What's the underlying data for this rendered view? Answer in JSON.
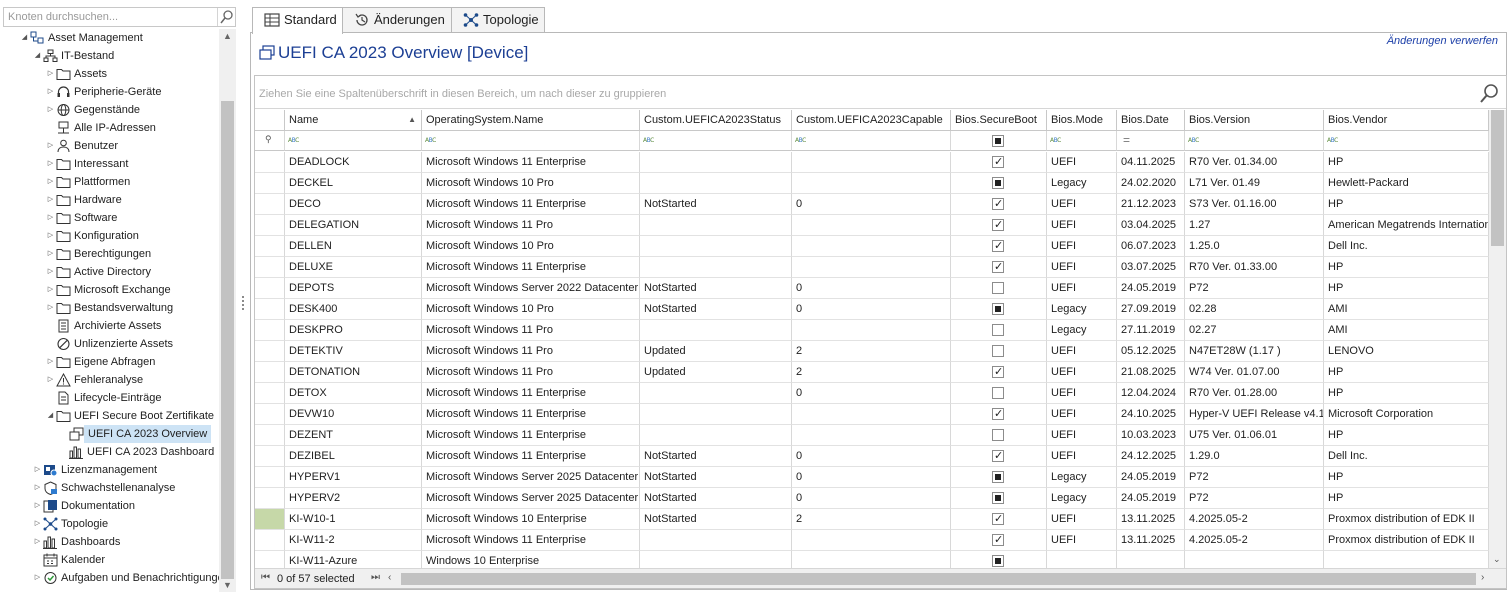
{
  "left_panel": {
    "search_placeholder": "Knoten durchsuchen...",
    "tree": [
      {
        "label": "Asset Management",
        "level": 0,
        "expanded": true,
        "icon": "asset-management-icon"
      },
      {
        "label": "IT-Bestand",
        "level": 1,
        "expanded": true,
        "icon": "network-icon"
      },
      {
        "label": "Assets",
        "level": 2,
        "expanded": false,
        "icon": "folder-icon"
      },
      {
        "label": "Peripherie-Geräte",
        "level": 2,
        "expanded": false,
        "icon": "headset-icon"
      },
      {
        "label": "Gegenstände",
        "level": 2,
        "expanded": false,
        "icon": "globe-icon"
      },
      {
        "label": "Alle IP-Adressen",
        "level": 2,
        "expanded": null,
        "icon": "ip-network-icon"
      },
      {
        "label": "Benutzer",
        "level": 2,
        "expanded": false,
        "icon": "user-icon"
      },
      {
        "label": "Interessant",
        "level": 2,
        "expanded": false,
        "icon": "folder-icon"
      },
      {
        "label": "Plattformen",
        "level": 2,
        "expanded": false,
        "icon": "folder-icon"
      },
      {
        "label": "Hardware",
        "level": 2,
        "expanded": false,
        "icon": "folder-icon"
      },
      {
        "label": "Software",
        "level": 2,
        "expanded": false,
        "icon": "folder-icon"
      },
      {
        "label": "Konfiguration",
        "level": 2,
        "expanded": false,
        "icon": "folder-icon"
      },
      {
        "label": "Berechtigungen",
        "level": 2,
        "expanded": false,
        "icon": "folder-icon"
      },
      {
        "label": "Active Directory",
        "level": 2,
        "expanded": false,
        "icon": "folder-icon"
      },
      {
        "label": "Microsoft Exchange",
        "level": 2,
        "expanded": false,
        "icon": "folder-icon"
      },
      {
        "label": "Bestandsverwaltung",
        "level": 2,
        "expanded": false,
        "icon": "folder-icon"
      },
      {
        "label": "Archivierte Assets",
        "level": 2,
        "expanded": null,
        "icon": "archive-icon"
      },
      {
        "label": "Unlizenzierte Assets",
        "level": 2,
        "expanded": null,
        "icon": "forbidden-icon"
      },
      {
        "label": "Eigene Abfragen",
        "level": 2,
        "expanded": false,
        "icon": "folder-icon"
      },
      {
        "label": "Fehleranalyse",
        "level": 2,
        "expanded": false,
        "icon": "warning-icon"
      },
      {
        "label": "Lifecycle-Einträge",
        "level": 2,
        "expanded": null,
        "icon": "document-icon"
      },
      {
        "label": "UEFI Secure Boot Zertifikate",
        "level": 2,
        "expanded": true,
        "icon": "folder-icon"
      },
      {
        "label": "UEFI CA 2023 Overview",
        "level": 3,
        "expanded": null,
        "icon": "view-icon",
        "selected": true
      },
      {
        "label": "UEFI CA 2023 Dashboard",
        "level": 3,
        "expanded": null,
        "icon": "bar-chart-icon"
      },
      {
        "label": "Lizenzmanagement",
        "level": 1,
        "expanded": false,
        "icon": "license-icon"
      },
      {
        "label": "Schwachstellenanalyse",
        "level": 1,
        "expanded": false,
        "icon": "shield-icon"
      },
      {
        "label": "Dokumentation",
        "level": 1,
        "expanded": false,
        "icon": "documentation-icon"
      },
      {
        "label": "Topologie",
        "level": 1,
        "expanded": false,
        "icon": "topology-icon"
      },
      {
        "label": "Dashboards",
        "level": 1,
        "expanded": false,
        "icon": "bar-chart-icon"
      },
      {
        "label": "Kalender",
        "level": 1,
        "expanded": null,
        "icon": "calendar-icon"
      },
      {
        "label": "Aufgaben und Benachrichtigungen",
        "level": 1,
        "expanded": false,
        "icon": "tasks-icon"
      }
    ]
  },
  "tabs": [
    {
      "label": "Standard",
      "icon": "table-icon",
      "active": true
    },
    {
      "label": "Änderungen",
      "icon": "history-icon",
      "active": false
    },
    {
      "label": "Topologie",
      "icon": "topology-icon",
      "active": false
    }
  ],
  "view": {
    "title": "UEFI CA 2023 Overview  [Device]",
    "discard_link": "Änderungen verwerfen",
    "group_panel_text": "Ziehen Sie eine Spaltenüberschrift in diesen Bereich, um nach dieser zu gruppieren"
  },
  "grid": {
    "columns": [
      "Name",
      "OperatingSystem.Name",
      "Custom.UEFICA2023Status",
      "Custom.UEFICA2023Capable",
      "Bios.SecureBoot",
      "Bios.Mode",
      "Bios.Date",
      "Bios.Version",
      "Bios.Vendor"
    ],
    "sorted_column": "Name",
    "rows": [
      {
        "name": "DEADLOCK",
        "os": "Microsoft Windows 11 Enterprise",
        "status": "",
        "capable": "",
        "secureboot": "checked",
        "mode": "UEFI",
        "date": "04.11.2025",
        "version": "R70 Ver. 01.34.00",
        "vendor": "HP"
      },
      {
        "name": "DECKEL",
        "os": "Microsoft Windows 10 Pro",
        "status": "",
        "capable": "",
        "secureboot": "indeterminate",
        "mode": "Legacy",
        "date": "24.02.2020",
        "version": "L71 Ver. 01.49",
        "vendor": "Hewlett-Packard"
      },
      {
        "name": "DECO",
        "os": "Microsoft Windows 11 Enterprise",
        "status": "NotStarted",
        "capable": "0",
        "secureboot": "checked",
        "mode": "UEFI",
        "date": "21.12.2023",
        "version": "S73 Ver. 01.16.00",
        "vendor": "HP"
      },
      {
        "name": "DELEGATION",
        "os": "Microsoft Windows 11 Pro",
        "status": "",
        "capable": "",
        "secureboot": "checked",
        "mode": "UEFI",
        "date": "03.04.2025",
        "version": "1.27",
        "vendor": "American Megatrends International"
      },
      {
        "name": "DELLEN",
        "os": "Microsoft Windows 10 Pro",
        "status": "",
        "capable": "",
        "secureboot": "checked",
        "mode": "UEFI",
        "date": "06.07.2023",
        "version": "1.25.0",
        "vendor": "Dell Inc."
      },
      {
        "name": "DELUXE",
        "os": "Microsoft Windows 11 Enterprise",
        "status": "",
        "capable": "",
        "secureboot": "checked",
        "mode": "UEFI",
        "date": "03.07.2025",
        "version": "R70 Ver. 01.33.00",
        "vendor": "HP"
      },
      {
        "name": "DEPOTS",
        "os": "Microsoft Windows Server 2022 Datacenter",
        "status": "NotStarted",
        "capable": "0",
        "secureboot": "unchecked",
        "mode": "UEFI",
        "date": "24.05.2019",
        "version": "P72",
        "vendor": "HP"
      },
      {
        "name": "DESK400",
        "os": "Microsoft Windows 10 Pro",
        "status": "NotStarted",
        "capable": "0",
        "secureboot": "indeterminate",
        "mode": "Legacy",
        "date": "27.09.2019",
        "version": "02.28",
        "vendor": "AMI"
      },
      {
        "name": "DESKPRO",
        "os": "Microsoft Windows 11 Pro",
        "status": "",
        "capable": "",
        "secureboot": "unchecked",
        "mode": "Legacy",
        "date": "27.11.2019",
        "version": "02.27",
        "vendor": "AMI"
      },
      {
        "name": "DETEKTIV",
        "os": "Microsoft Windows 11 Pro",
        "status": "Updated",
        "capable": "2",
        "secureboot": "unchecked",
        "mode": "UEFI",
        "date": "05.12.2025",
        "version": "N47ET28W (1.17 )",
        "vendor": "LENOVO"
      },
      {
        "name": "DETONATION",
        "os": "Microsoft Windows 11 Pro",
        "status": "Updated",
        "capable": "2",
        "secureboot": "checked",
        "mode": "UEFI",
        "date": "21.08.2025",
        "version": "W74 Ver. 01.07.00",
        "vendor": "HP"
      },
      {
        "name": "DETOX",
        "os": "Microsoft Windows 11 Enterprise",
        "status": "",
        "capable": "0",
        "secureboot": "unchecked",
        "mode": "UEFI",
        "date": "12.04.2024",
        "version": "R70 Ver. 01.28.00",
        "vendor": "HP"
      },
      {
        "name": "DEVW10",
        "os": "Microsoft Windows 11 Enterprise",
        "status": "",
        "capable": "",
        "secureboot": "checked",
        "mode": "UEFI",
        "date": "24.10.2025",
        "version": "Hyper-V UEFI Release v4.1",
        "vendor": "Microsoft Corporation"
      },
      {
        "name": "DEZENT",
        "os": "Microsoft Windows 11 Enterprise",
        "status": "",
        "capable": "",
        "secureboot": "unchecked",
        "mode": "UEFI",
        "date": "10.03.2023",
        "version": "U75 Ver. 01.06.01",
        "vendor": "HP"
      },
      {
        "name": "DEZIBEL",
        "os": "Microsoft Windows 11 Enterprise",
        "status": "NotStarted",
        "capable": "0",
        "secureboot": "checked",
        "mode": "UEFI",
        "date": "24.12.2025",
        "version": "1.29.0",
        "vendor": "Dell Inc."
      },
      {
        "name": "HYPERV1",
        "os": "Microsoft Windows Server 2025 Datacenter",
        "status": "NotStarted",
        "capable": "0",
        "secureboot": "indeterminate",
        "mode": "Legacy",
        "date": "24.05.2019",
        "version": "P72",
        "vendor": "HP"
      },
      {
        "name": "HYPERV2",
        "os": "Microsoft Windows Server 2025 Datacenter",
        "status": "NotStarted",
        "capable": "0",
        "secureboot": "indeterminate",
        "mode": "Legacy",
        "date": "24.05.2019",
        "version": "P72",
        "vendor": "HP"
      },
      {
        "name": "KI-W10-1",
        "os": "Microsoft Windows 10 Enterprise",
        "status": "NotStarted",
        "capable": "2",
        "secureboot": "checked",
        "mode": "UEFI",
        "date": "13.11.2025",
        "version": "4.2025.05-2",
        "vendor": "Proxmox distribution of EDK II",
        "marker": true
      },
      {
        "name": "KI-W11-2",
        "os": "Microsoft Windows 11 Enterprise",
        "status": "",
        "capable": "",
        "secureboot": "checked",
        "mode": "UEFI",
        "date": "13.11.2025",
        "version": "4.2025.05-2",
        "vendor": "Proxmox distribution of EDK II"
      },
      {
        "name": "KI-W11-Azure",
        "os": "Windows 10 Enterprise",
        "status": "",
        "capable": "",
        "secureboot": "indeterminate",
        "mode": "",
        "date": "",
        "version": "",
        "vendor": ""
      }
    ],
    "footer": {
      "selection_text": "0 of 57 selected",
      "first_icon": "first-page-icon",
      "last_icon": "last-page-icon"
    }
  },
  "colors": {
    "title": "#1c3f94",
    "selected_tree": "#cde3f5",
    "row_marker": "#c6d8a8"
  }
}
